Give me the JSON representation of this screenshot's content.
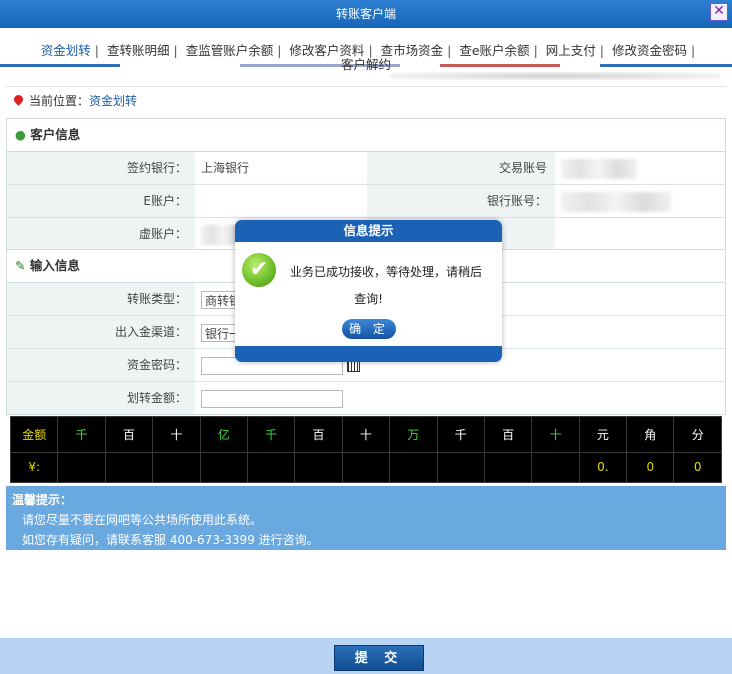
{
  "window": {
    "title": "转账客户端",
    "close_icon": "✕"
  },
  "tabs": [
    {
      "label": "资金划转"
    },
    {
      "label": "查转账明细"
    },
    {
      "label": "查监管账户余额"
    },
    {
      "label": "修改客户资料"
    },
    {
      "label": "查市场资金"
    },
    {
      "label": "查e账户余额"
    },
    {
      "label": "网上支付"
    },
    {
      "label": "修改资金密码"
    },
    {
      "label": "客户解约"
    }
  ],
  "location": {
    "prefix": "当前位置：",
    "current": "资金划转"
  },
  "customer_info": {
    "title": "客户信息",
    "signed_bank_label": "签约银行：",
    "signed_bank_value": "上海银行",
    "trade_account_label": "交易账号",
    "e_account_label": "E账户：",
    "bank_account_label": "银行账号：",
    "virtual_account_label": "虚账户："
  },
  "input_info": {
    "title": "输入信息",
    "transfer_type_label": "转账类型：",
    "transfer_type_value": "商转银",
    "channel_label": "出入金渠道：",
    "channel_value": "银行一",
    "password_label": "资金密码：",
    "amount_label": "划转金额："
  },
  "amount_grid": {
    "header": [
      "金额",
      "千",
      "百",
      "十",
      "亿",
      "千",
      "百",
      "十",
      "万",
      "千",
      "百",
      "十",
      "元",
      "角",
      "分"
    ],
    "values": [
      "¥:",
      "",
      "",
      "",
      "",
      "",
      "",
      "",
      "",
      "",
      "",
      "",
      "0.",
      "0",
      "0"
    ]
  },
  "tips": {
    "title": "温馨提示：",
    "line1": "请您尽量不要在网吧等公共场所使用此系统。",
    "line2": "如您存有疑问，请联系客服  400-673-3399 进行咨询。"
  },
  "submit_label": "提 交",
  "modal": {
    "title": "信息提示",
    "message_line1": "业务已成功接收，等待处理，请稍后",
    "message_line2": "查询!",
    "ok_label": "确 定",
    "check_symbol": "✔"
  },
  "colors": {
    "accent": "#1b62b6",
    "header_bar": "#1565b8",
    "tips_bg": "#6aa8e0",
    "green_digit": "#3adc3a",
    "yellow_digit": "#e8d800"
  }
}
